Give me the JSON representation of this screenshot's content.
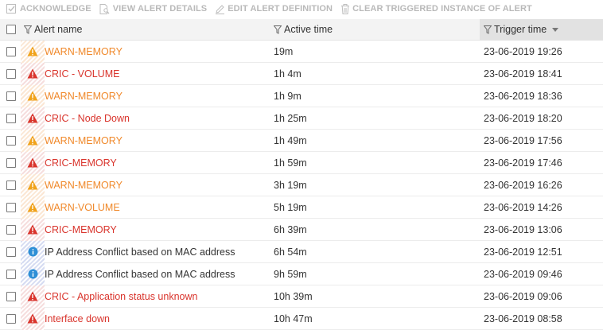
{
  "toolbar": {
    "acknowledge": "ACKNOWLEDGE",
    "view_details": "VIEW ALERT DETAILS",
    "edit_definition": "EDIT ALERT DEFINITION",
    "clear_instance": "CLEAR TRIGGERED INSTANCE OF ALERT"
  },
  "columns": {
    "name": "Alert name",
    "active": "Active time",
    "trigger": "Trigger time"
  },
  "sort": {
    "column": "trigger",
    "direction": "descending"
  },
  "severity_colors": {
    "critical": "#d9342c",
    "warning": "#f0a21a",
    "info": "#2e8fd6"
  },
  "rows": [
    {
      "severity": "warning",
      "name": "WARN-MEMORY",
      "active": "19m",
      "trigger": "23-06-2019 19:26"
    },
    {
      "severity": "critical",
      "name": "CRIC - VOLUME",
      "active": "1h 4m",
      "trigger": "23-06-2019 18:41"
    },
    {
      "severity": "warning",
      "name": "WARN-MEMORY",
      "active": "1h 9m",
      "trigger": "23-06-2019 18:36"
    },
    {
      "severity": "critical",
      "name": "CRIC - Node Down",
      "active": "1h 25m",
      "trigger": "23-06-2019 18:20"
    },
    {
      "severity": "warning",
      "name": "WARN-MEMORY",
      "active": "1h 49m",
      "trigger": "23-06-2019 17:56"
    },
    {
      "severity": "critical",
      "name": "CRIC-MEMORY",
      "active": "1h 59m",
      "trigger": "23-06-2019 17:46"
    },
    {
      "severity": "warning",
      "name": "WARN-MEMORY",
      "active": "3h 19m",
      "trigger": "23-06-2019 16:26"
    },
    {
      "severity": "warning",
      "name": "WARN-VOLUME",
      "active": "5h 19m",
      "trigger": "23-06-2019 14:26"
    },
    {
      "severity": "critical",
      "name": "CRIC-MEMORY",
      "active": "6h 39m",
      "trigger": "23-06-2019 13:06"
    },
    {
      "severity": "info",
      "name": "IP Address Conflict based on MAC address",
      "active": "6h 54m",
      "trigger": "23-06-2019 12:51"
    },
    {
      "severity": "info",
      "name": "IP Address Conflict based on MAC address",
      "active": "9h 59m",
      "trigger": "23-06-2019 09:46"
    },
    {
      "severity": "critical",
      "name": "CRIC - Application status unknown",
      "active": "10h 39m",
      "trigger": "23-06-2019 09:06"
    },
    {
      "severity": "critical",
      "name": "Interface down",
      "active": "10h 47m",
      "trigger": "23-06-2019 08:58"
    }
  ]
}
